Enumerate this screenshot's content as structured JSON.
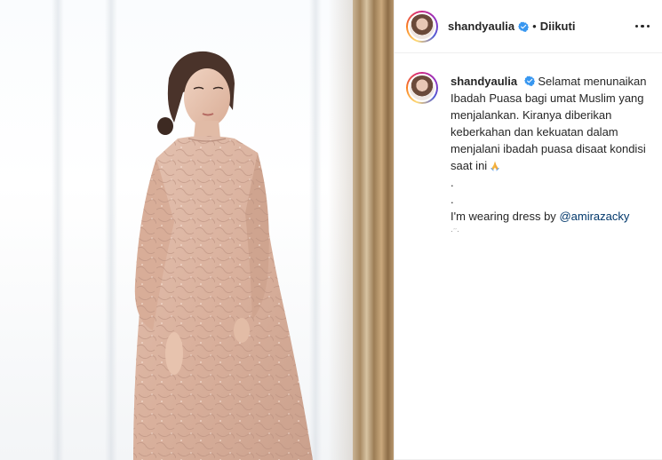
{
  "post": {
    "author": {
      "username": "shandyaulia",
      "verified": true,
      "avatar_icon": "avatar-photo",
      "follow_status": "Diikuti",
      "separator": "•"
    },
    "caption": {
      "username": "shandyaulia",
      "lines": [
        "Selamat menunaikan",
        "Ibadah Puasa bagi umat Muslim yang",
        "menjalankan. Kiranya diberikan",
        "keberkahan dan kekuatan dalam",
        "menjalani ibadah puasa disaat kondisi",
        "saat ini"
      ],
      "emoji_icon": "folded-hands-emoji",
      "dots": [
        ".",
        "."
      ],
      "dress_text": "I'm wearing dress by",
      "mention": "@amirazacky"
    },
    "colors": {
      "verified_blue": "#3897f0",
      "mention_blue": "#00376b",
      "text": "#262626",
      "divider": "#efefef"
    },
    "icons": {
      "more_options": "more-options-icon",
      "verified": "verified-badge-icon"
    }
  }
}
